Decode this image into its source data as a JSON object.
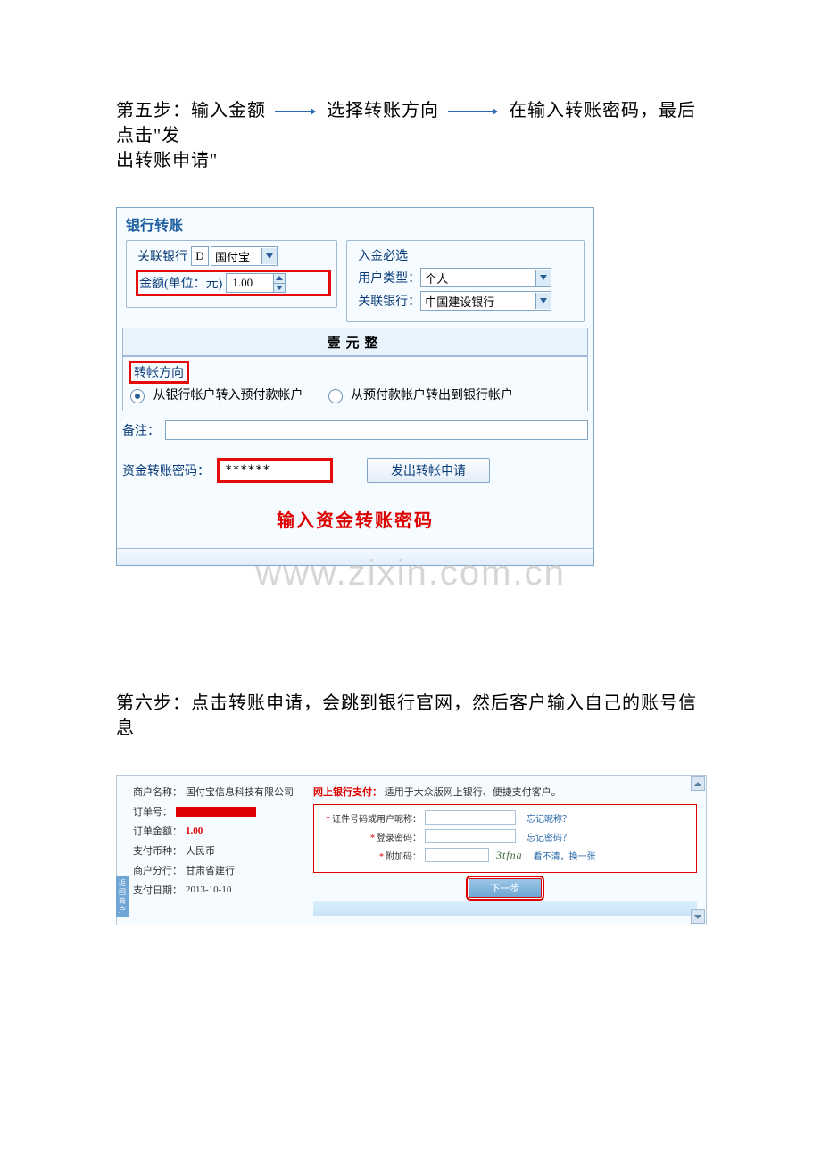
{
  "step5": {
    "line1_a": "第五步：输入金额",
    "line1_b": "选择转账方向",
    "line1_c": "在输入转账密码，最后点击\"发",
    "line2": "出转账申请\""
  },
  "shot1": {
    "title": "银行转账",
    "assoc_bank_label": "关联银行",
    "assoc_bank_code": "D",
    "assoc_bank_value": "国付宝",
    "amount_label": "金额(单位：元)",
    "amount_value": "1.00",
    "deposit_legend": "入金必选",
    "user_type_label": "用户类型：",
    "user_type_value": "个人",
    "deposit_bank_label": "关联银行：",
    "deposit_bank_value": "中国建设银行",
    "amount_cn": "壹元整",
    "direction_title": "转帐方向",
    "direction_opt1": "从银行帐户转入预付款帐户",
    "direction_opt2": "从预付款帐户转出到银行帐户",
    "remark_label": "备注：",
    "pwd_label": "资金转账密码：",
    "pwd_value": "******",
    "submit_label": "发出转帐申请",
    "hint": "输入资金转账密码"
  },
  "watermark": "www.zixin.com.cn",
  "step6": "第六步：点击转账申请，会跳到银行官网，然后客户输入自己的账号信息",
  "shot2": {
    "side_tab": "返回商户",
    "info": {
      "merchant_label": "商户名称：",
      "merchant_value": "国付宝信息科技有限公司",
      "order_label": "订单号：",
      "amount_label": "订单金额：",
      "amount_value": "1.00",
      "currency_label": "支付币种：",
      "currency_value": "人民币",
      "branch_label": "商户分行：",
      "branch_value": "甘肃省建行",
      "date_label": "支付日期：",
      "date_value": "2013-10-10"
    },
    "pay": {
      "title": "网上银行支付：",
      "sub": "适用于大众版网上银行、便捷支付客户。",
      "id_label": "证件号码或用户昵称：",
      "id_link": "忘记昵称？",
      "pwd_label": "登录密码：",
      "pwd_link": "忘记密码？",
      "code_label": "附加码：",
      "captcha": "3tfna",
      "captcha_hint": "看不清，换一张",
      "next": "下一步"
    }
  }
}
